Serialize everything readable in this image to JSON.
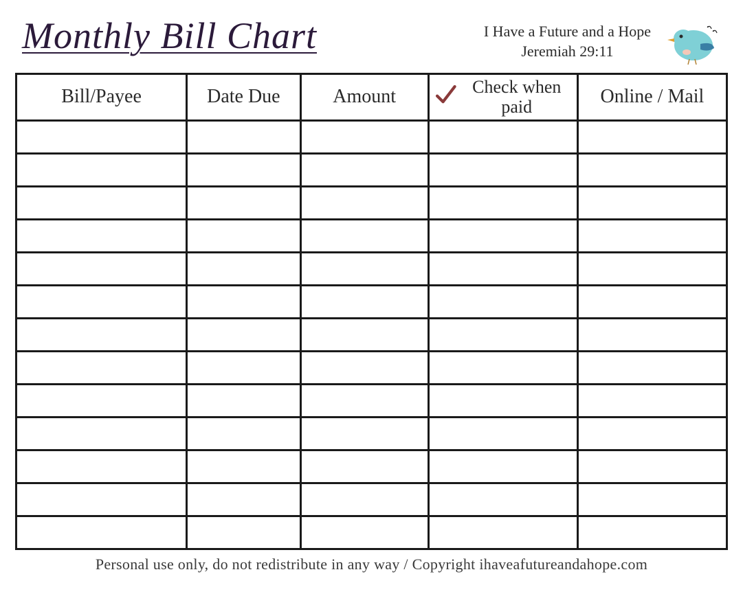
{
  "header": {
    "title": "Monthly Bill Chart",
    "tagline_line1": "I Have a Future and a Hope",
    "tagline_line2": "Jeremiah 29:11"
  },
  "table": {
    "columns": {
      "payee": "Bill/Payee",
      "date_due": "Date Due",
      "amount": "Amount",
      "check_paid": "Check when paid",
      "online_mail": "Online / Mail"
    },
    "row_count": 13
  },
  "footer": {
    "text": "Personal use only, do not redistribute in any way / Copyright ihaveafutureandahope.com"
  }
}
